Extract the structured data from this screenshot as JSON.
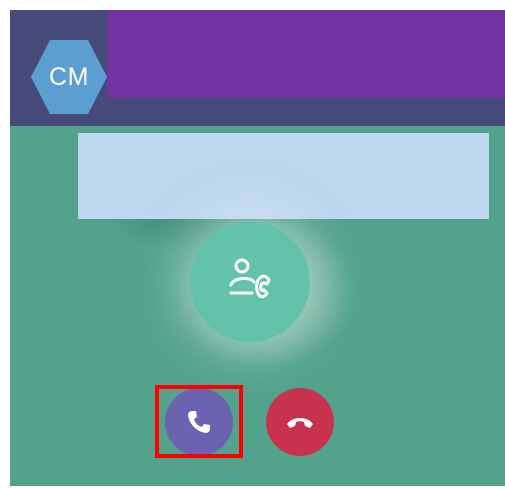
{
  "header": {
    "avatar_initials": "CM"
  },
  "icons": {
    "center": "person-transfer-call-icon",
    "accept": "phone-icon",
    "decline": "hang-up-icon"
  },
  "colors": {
    "header_bg": "#454a79",
    "purple_bar": "#7232a0",
    "avatar_hex": "#5b9fd1",
    "call_bg": "#52a28c",
    "center_icon_bg": "#63c2aa",
    "accept_bg": "#6b62b0",
    "decline_bg": "#c7334e",
    "highlight": "#ff0000",
    "name_placeholder": "#bdd7ee"
  }
}
